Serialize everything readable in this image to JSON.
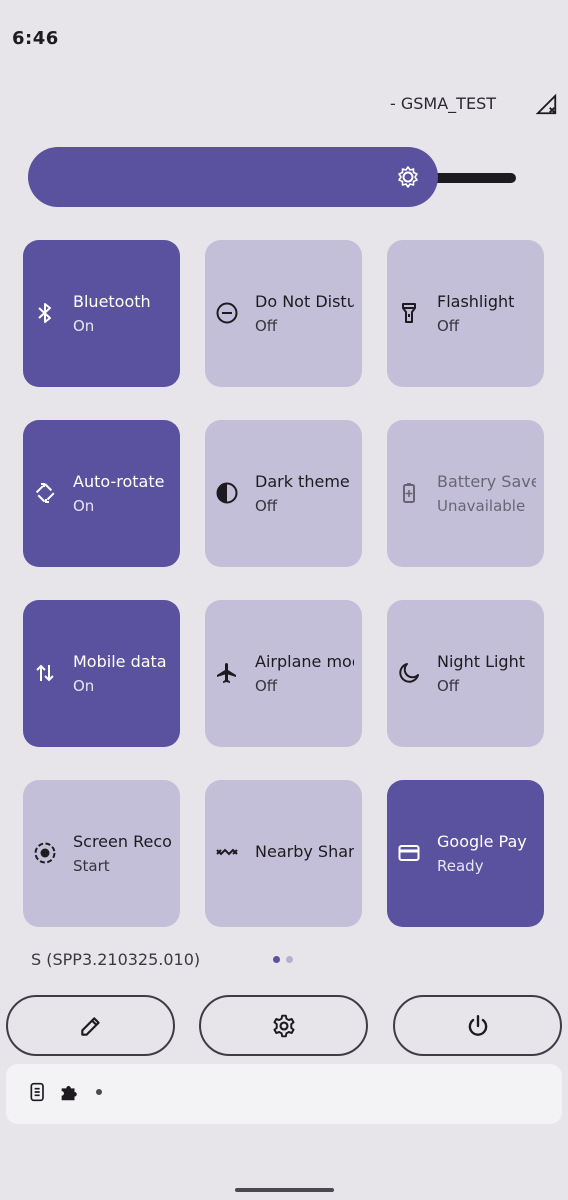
{
  "status_bar": {
    "time": "6:46",
    "carrier": "- GSMA_TEST"
  },
  "brightness": {
    "level": 0.84
  },
  "tiles": [
    {
      "label": "Bluetooth",
      "state": "On",
      "icon": "bluetooth-icon",
      "active": true
    },
    {
      "label": "Do Not Disturb",
      "state": "Off",
      "icon": "do-not-disturb-icon",
      "active": false
    },
    {
      "label": "Flashlight",
      "state": "Off",
      "icon": "flashlight-icon",
      "active": false
    },
    {
      "label": "Auto-rotate",
      "state": "On",
      "icon": "auto-rotate-icon",
      "active": true
    },
    {
      "label": "Dark theme",
      "state": "Off",
      "icon": "dark-theme-icon",
      "active": false
    },
    {
      "label": "Battery Saver",
      "state": "Unavailable",
      "icon": "battery-saver-icon",
      "active": false
    },
    {
      "label": "Mobile data",
      "state": "On",
      "icon": "mobile-data-icon",
      "active": true
    },
    {
      "label": "Airplane mode",
      "state": "Off",
      "icon": "airplane-icon",
      "active": false
    },
    {
      "label": "Night Light",
      "state": "Off",
      "icon": "night-light-icon",
      "active": false
    },
    {
      "label": "Screen Record",
      "state": "Start",
      "icon": "screen-record-icon",
      "active": false
    },
    {
      "label": "Nearby Share",
      "state": "",
      "icon": "nearby-share-icon",
      "active": false
    },
    {
      "label": "Google Pay",
      "state": "Ready",
      "icon": "card-icon",
      "active": true
    }
  ],
  "footer": {
    "build": "S (SPP3.210325.010)",
    "page_indicator": {
      "pages": 2,
      "current": 1
    }
  },
  "buttons": [
    {
      "name": "edit",
      "icon": "pencil-icon"
    },
    {
      "name": "settings",
      "icon": "gear-icon"
    },
    {
      "name": "power",
      "icon": "power-icon"
    }
  ],
  "notification_bar": {
    "icons": [
      "sim-icon",
      "puzzle-icon",
      "dot-icon"
    ]
  },
  "colors": {
    "accent": "#5a529e",
    "tile_off": "#c4bfd8",
    "background": "#e7e5ea"
  }
}
